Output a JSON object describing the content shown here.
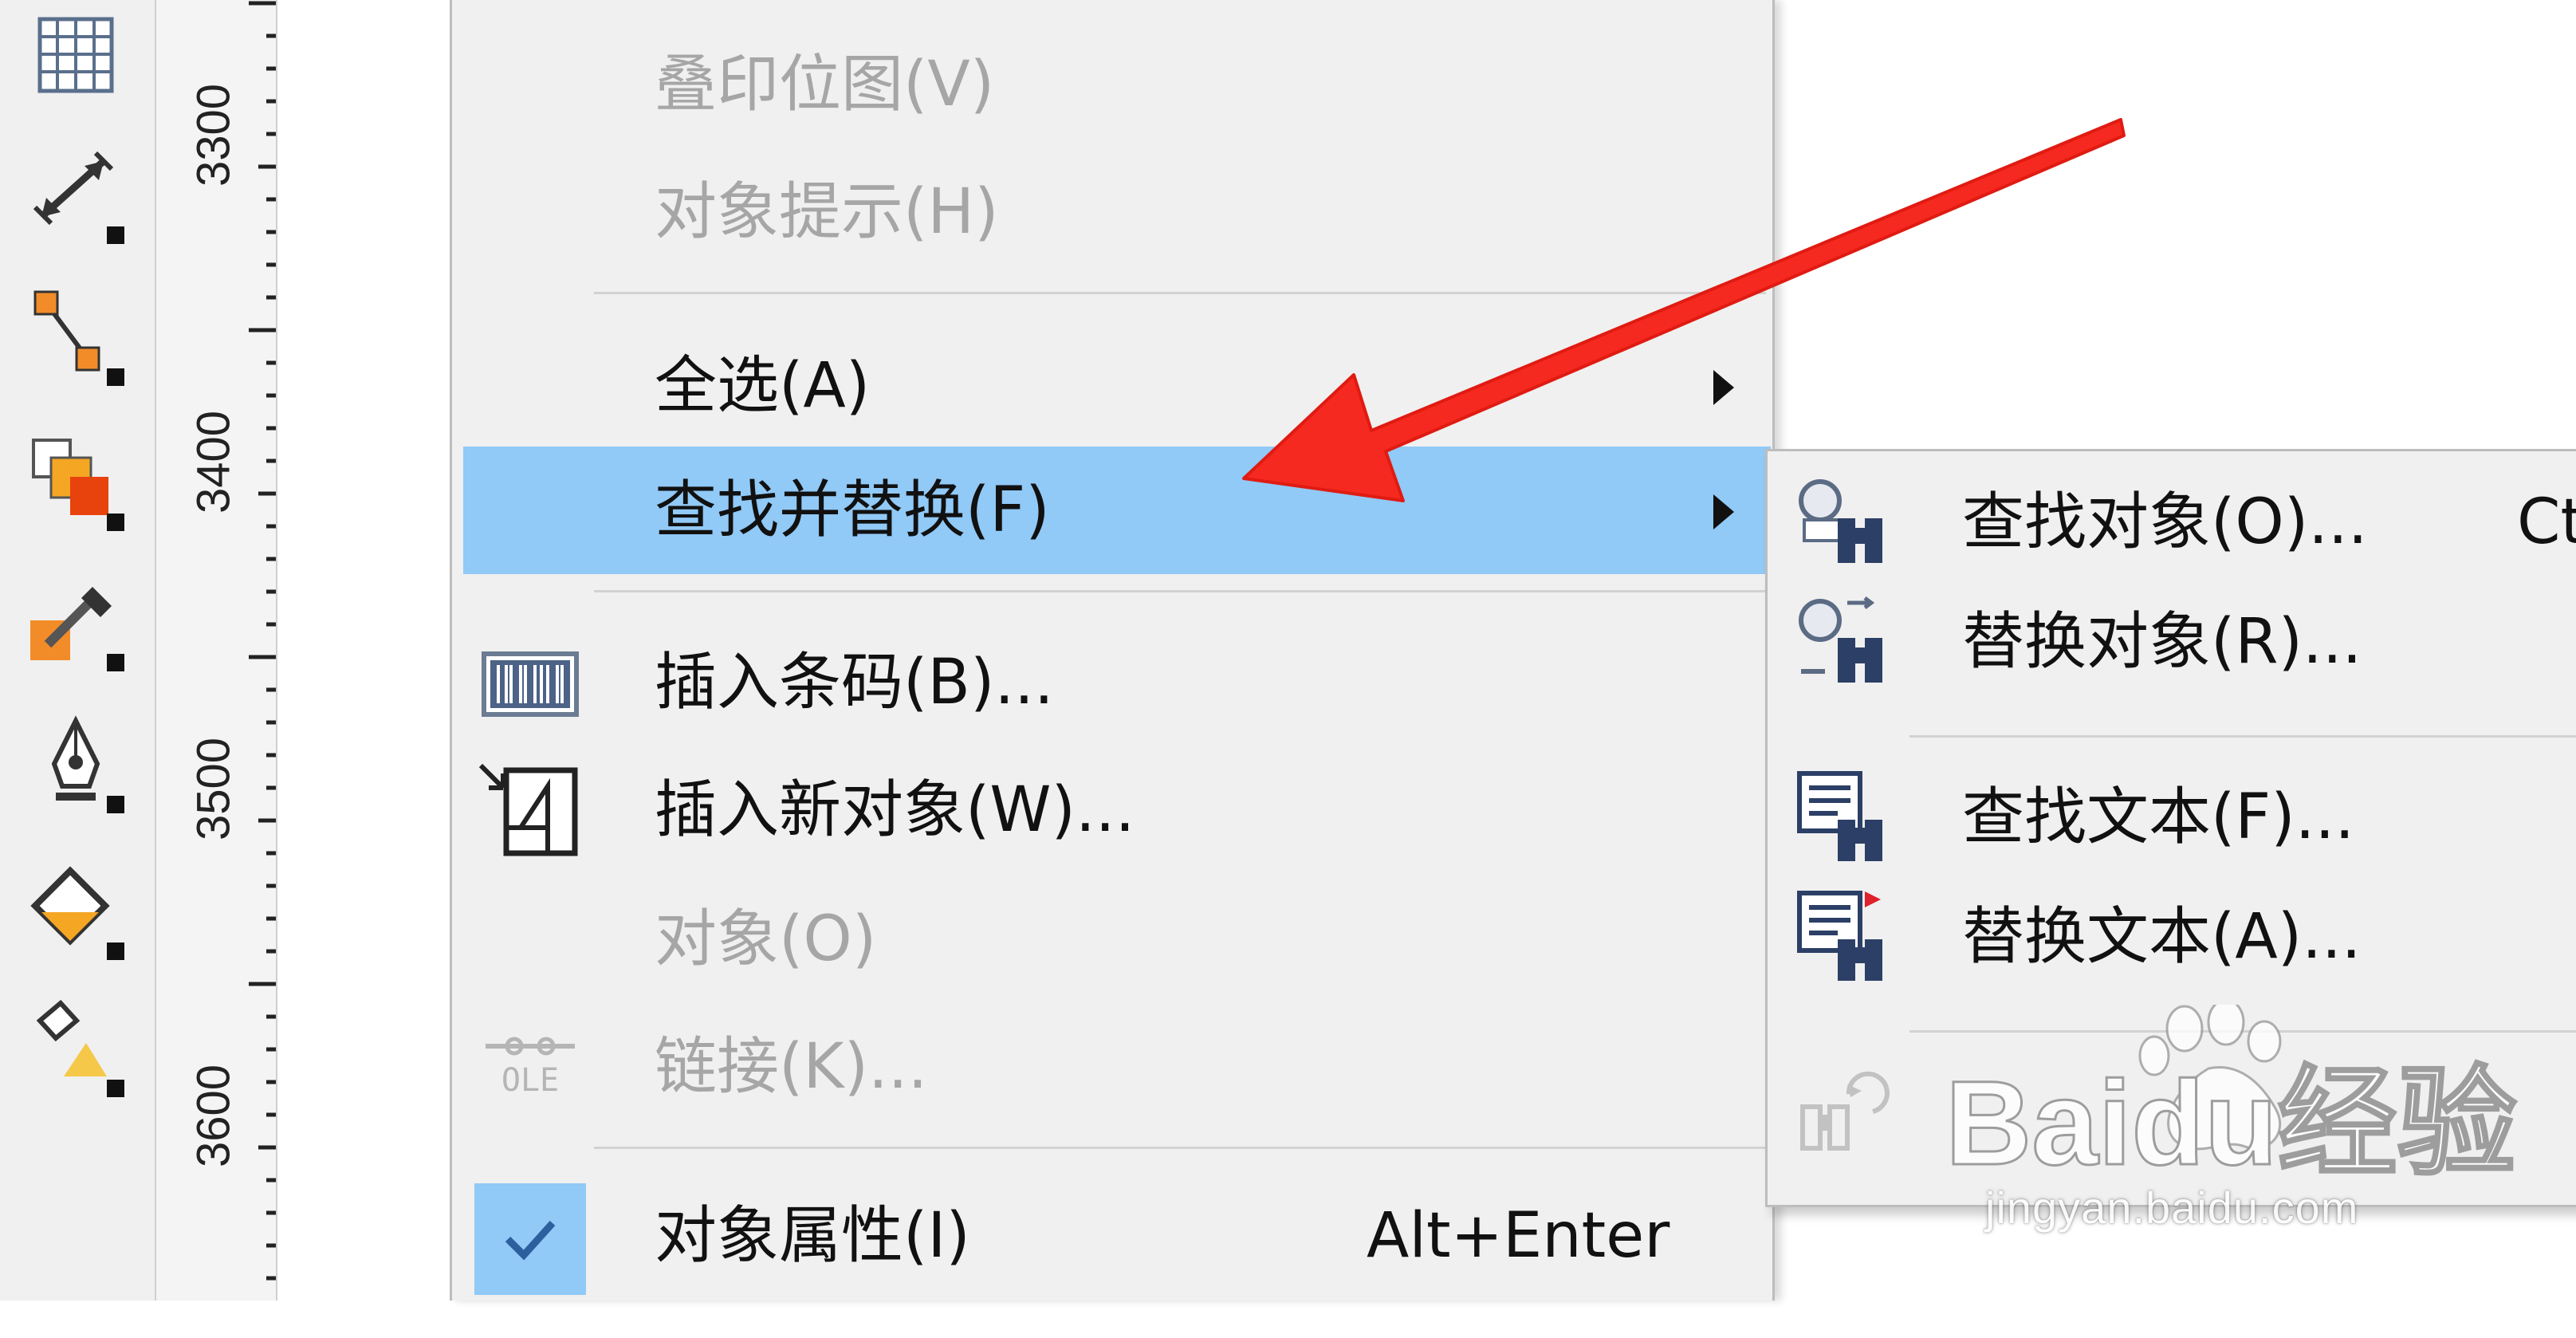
{
  "ruler": {
    "labels": [
      "3300",
      "3400",
      "3500",
      "3600"
    ]
  },
  "menu": {
    "items": [
      {
        "label": "叠印位图(V)",
        "state": "disabled"
      },
      {
        "label": "对象提示(H)",
        "state": "disabled"
      },
      {
        "label": "全选(A)",
        "state": "enabled",
        "submenu": true
      },
      {
        "label": "查找并替换(F)",
        "state": "highlighted",
        "submenu": true
      },
      {
        "label": "插入条码(B)...",
        "state": "enabled",
        "icon": "barcode-icon"
      },
      {
        "label": "插入新对象(W)...",
        "state": "enabled",
        "icon": "insert-object-icon"
      },
      {
        "label": "对象(O)",
        "state": "disabled"
      },
      {
        "label": "链接(K)...",
        "state": "disabled",
        "icon": "ole-link-icon"
      },
      {
        "label": "对象属性(I)",
        "shortcut": "Alt+Enter",
        "state": "enabled",
        "checked": true
      }
    ],
    "ole_text": "OLE"
  },
  "submenu": {
    "items": [
      {
        "label": "查找对象(O)...",
        "shortcut": "Ct",
        "icon": "find-object-icon"
      },
      {
        "label": "替换对象(R)...",
        "icon": "replace-object-icon"
      },
      {
        "label": "查找文本(F)...",
        "icon": "find-text-icon"
      },
      {
        "label": "替换文本(A)...",
        "icon": "replace-text-icon"
      },
      {
        "label": "",
        "state": "disabled",
        "icon": "binoculars-undo-icon"
      }
    ]
  },
  "watermark": {
    "logo_text": "Baidu经验",
    "url": "jingyan.baidu.com"
  },
  "colors": {
    "menu_bg": "#f0f0f0",
    "highlight": "#91c9f7",
    "disabled_text": "#a6a6a6",
    "annotation_arrow": "#f5291f"
  }
}
